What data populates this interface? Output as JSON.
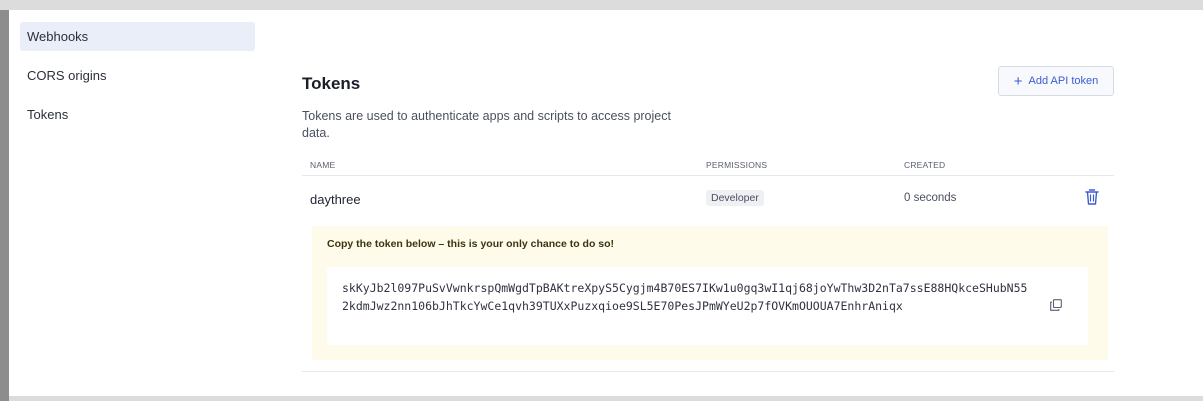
{
  "sidebar": {
    "items": [
      {
        "label": "Webhooks",
        "active": true
      },
      {
        "label": "CORS origins",
        "active": false
      },
      {
        "label": "Tokens",
        "active": false
      }
    ]
  },
  "tokens": {
    "title": "Tokens",
    "description": "Tokens are used to authenticate apps and scripts to access project data.",
    "add_button": {
      "label": "Add API token",
      "icon": "plus-icon"
    },
    "columns": {
      "name": "NAME",
      "permissions": "PERMISSIONS",
      "created": "CREATED"
    },
    "rows": [
      {
        "name": "daythree",
        "permission": "Developer",
        "created": "0 seconds",
        "delete_icon": "trash-icon"
      }
    ],
    "notice": {
      "message": "Copy the token below – this is your only chance to do so!",
      "token": "skKyJb2l097PuSvVwnkrspQmWgdTpBAKtreXpyS5Cygjm4B70ES7IKw1u0gq3wI1qj68joYwThw3D2nTa7ssE88HQkceSHubN552kdmJwz2nn106bJhTkcYwCe1qvh39TUXxPuzxqioe9SL5E70PesJPmWYeU2p7fOVKmOUOUA7EnhrAniqx",
      "copy_icon": "copy-icon"
    }
  },
  "colors": {
    "accent": "#3b5bd6",
    "active_sidebar_bg": "#e9eef8",
    "notice_bg": "#fffbea"
  }
}
